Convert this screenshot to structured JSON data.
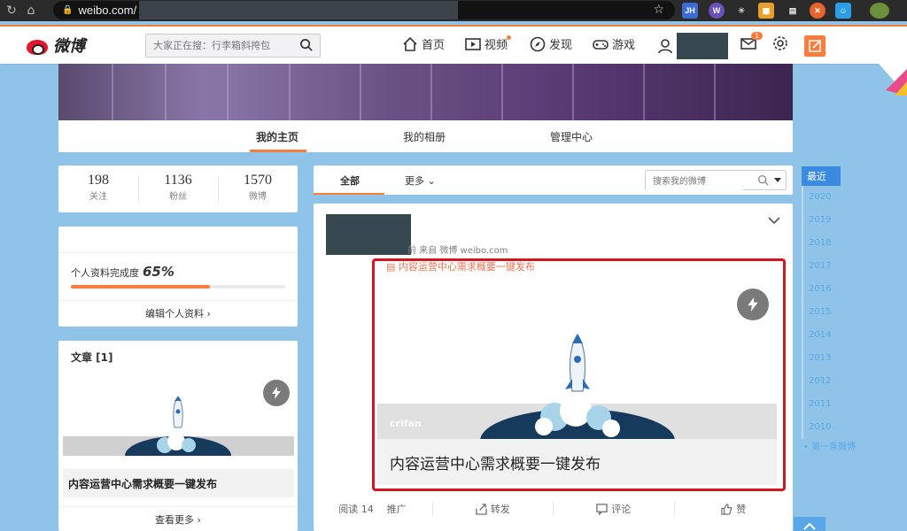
{
  "browser": {
    "url": "weibo.com/",
    "extensions": [
      "JH",
      "W",
      "☀",
      "▦",
      "▤",
      "✕",
      "☺"
    ]
  },
  "topnav": {
    "logo_text": "微博",
    "search_placeholder": "大家正在搜：行李箱斜挎包",
    "links": [
      "首页",
      "视频",
      "发现",
      "游戏"
    ],
    "message_badge": "1"
  },
  "profile_tabs": [
    "我的主页",
    "我的相册",
    "管理中心"
  ],
  "stats": [
    {
      "num": "198",
      "label": "关注"
    },
    {
      "num": "1136",
      "label": "粉丝"
    },
    {
      "num": "1570",
      "label": "微博"
    }
  ],
  "profile": {
    "completion_label": "个人资料完成度",
    "completion_value": "65%",
    "completion_fraction": 0.65,
    "edit_label": "编辑个人资料 ›"
  },
  "articles": {
    "title": "文章 [1]",
    "card_title": "内容运营中心需求概要一键发布",
    "more_label": "查看更多 ›"
  },
  "feed": {
    "tabs": [
      "全部",
      "更多 ⌄"
    ],
    "search_placeholder": "搜索我的微博"
  },
  "post": {
    "meta": "前 来自 微博 weibo.com",
    "article_link": "内容运营中心需求概要一键发布",
    "watermark": "crifan",
    "card_title": "内容运营中心需求概要一键发布",
    "actions": [
      "阅读 14",
      "推广",
      "转发",
      "评论",
      "赞"
    ]
  },
  "timeline": {
    "current": "最近",
    "years": [
      "2020",
      "2019",
      "2018",
      "2017",
      "2016",
      "2015",
      "2014",
      "2013",
      "2012",
      "2011",
      "2010"
    ],
    "first": "第一条微博"
  },
  "colors": {
    "accent": "#fa7d3c",
    "highlight": "#d5141f",
    "timeline": "#3a8be0"
  }
}
